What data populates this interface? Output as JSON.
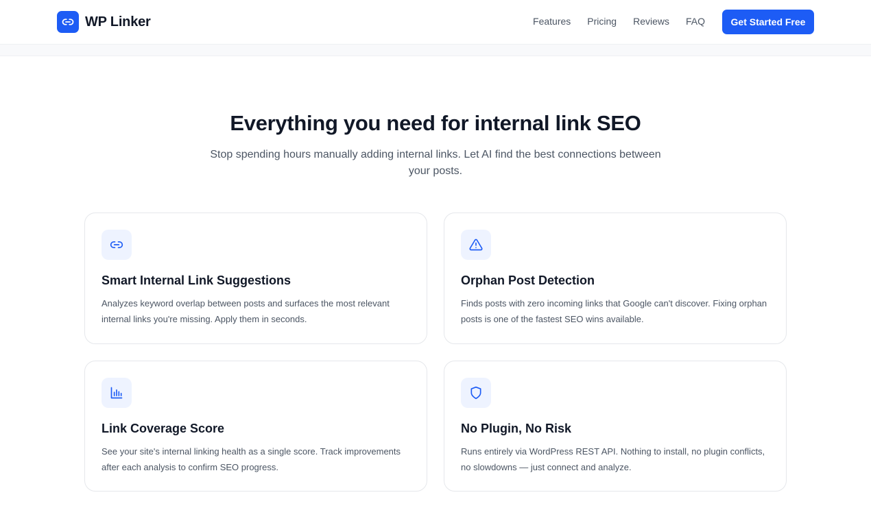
{
  "brand": {
    "name": "WP Linker",
    "logo_icon": "link-icon"
  },
  "nav": {
    "links": [
      "Features",
      "Pricing",
      "Reviews",
      "FAQ"
    ],
    "cta_label": "Get Started Free"
  },
  "features_section": {
    "title": "Everything you need for internal link SEO",
    "subtitle": "Stop spending hours manually adding internal links. Let AI find the best connections between your posts.",
    "cards": [
      {
        "icon": "link-icon",
        "title": "Smart Internal Link Suggestions",
        "description": "Analyzes keyword overlap between posts and surfaces the most relevant internal links you're missing. Apply them in seconds."
      },
      {
        "icon": "warning-triangle-icon",
        "title": "Orphan Post Detection",
        "description": "Finds posts with zero incoming links that Google can't discover. Fixing orphan posts is one of the fastest SEO wins available."
      },
      {
        "icon": "bar-chart-icon",
        "title": "Link Coverage Score",
        "description": "See your site's internal linking health as a single score. Track improvements after each analysis to confirm SEO progress."
      },
      {
        "icon": "shield-icon",
        "title": "No Plugin, No Risk",
        "description": "Runs entirely via WordPress REST API. Nothing to install, no plugin conflicts, no slowdowns — just connect and analyze."
      }
    ]
  },
  "colors": {
    "accent": "#1d5cf5",
    "icon_bg": "#eef3ff",
    "text_primary": "#111827",
    "text_secondary": "#4b5563",
    "border": "#e5e7eb"
  }
}
